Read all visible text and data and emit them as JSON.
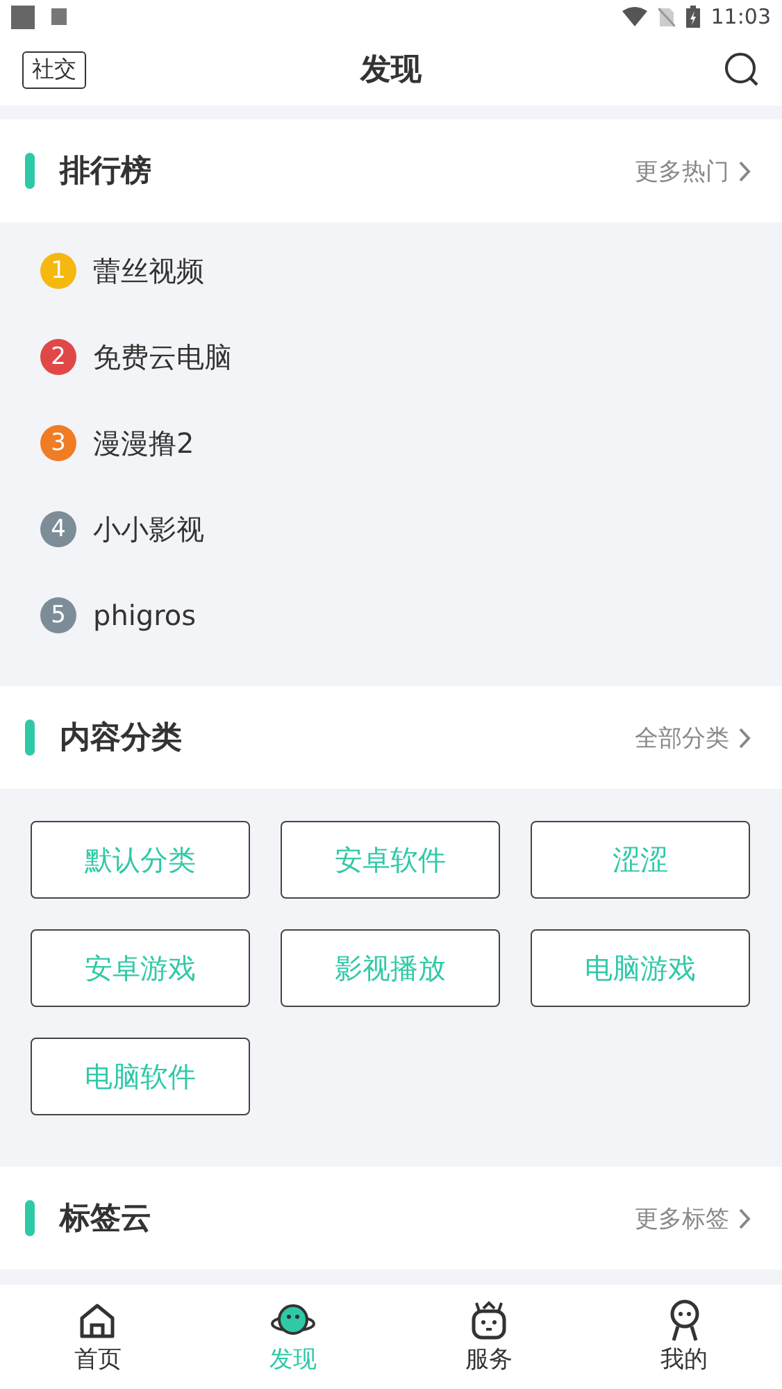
{
  "status_bar": {
    "time": "11:03"
  },
  "header": {
    "left_button": "社交",
    "title": "发现"
  },
  "ranking": {
    "title": "排行榜",
    "more": "更多热门",
    "items": [
      {
        "rank": "1",
        "name": "蕾丝视频",
        "color": "#f5b80f"
      },
      {
        "rank": "2",
        "name": "免费云电脑",
        "color": "#e04848"
      },
      {
        "rank": "3",
        "name": "漫漫撸2",
        "color": "#f07c24"
      },
      {
        "rank": "4",
        "name": "小小影视",
        "color": "#7d8d98"
      },
      {
        "rank": "5",
        "name": "phigros",
        "color": "#7d8d98"
      }
    ]
  },
  "categories": {
    "title": "内容分类",
    "more": "全部分类",
    "items": [
      "默认分类",
      "安卓软件",
      "涩涩",
      "安卓游戏",
      "影视播放",
      "电脑游戏",
      "电脑软件"
    ]
  },
  "tags": {
    "title": "标签云",
    "more": "更多标签"
  },
  "tab_bar": [
    {
      "label": "首页",
      "kind": "home",
      "selected": false
    },
    {
      "label": "发现",
      "kind": "planet",
      "selected": true
    },
    {
      "label": "服务",
      "kind": "robot",
      "selected": false
    },
    {
      "label": "我的",
      "kind": "person",
      "selected": false
    }
  ]
}
